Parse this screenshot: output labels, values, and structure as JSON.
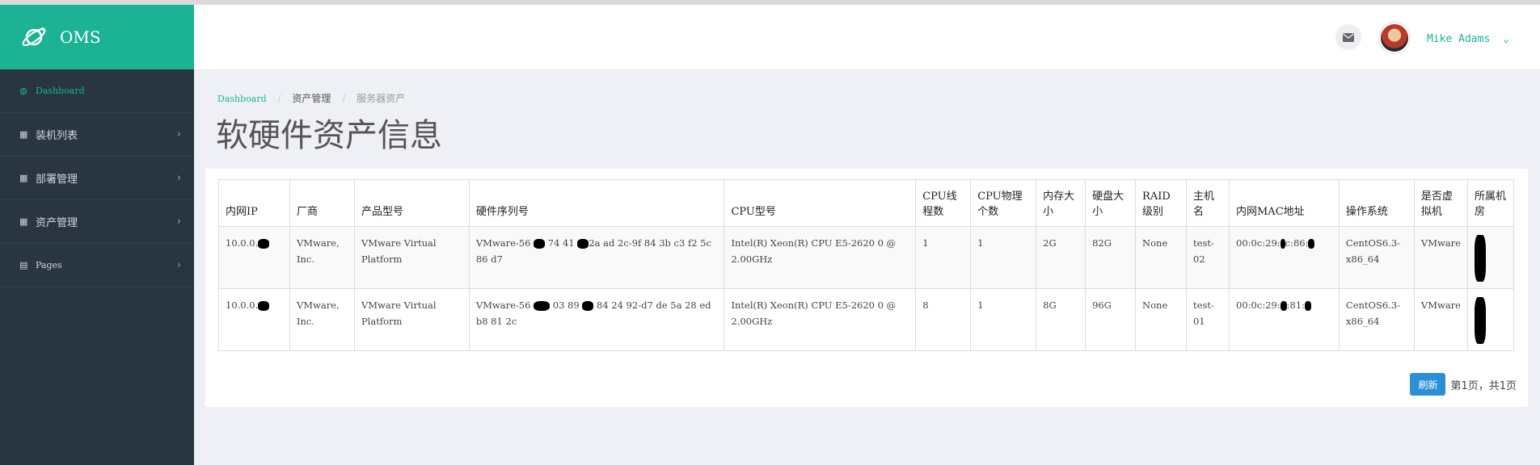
{
  "app": {
    "name": "OMS"
  },
  "sidebar": {
    "items": [
      {
        "label": "Dashboard",
        "icon": "dashboard-icon"
      },
      {
        "label": "装机列表",
        "icon": "table-icon"
      },
      {
        "label": "部署管理",
        "icon": "table-icon"
      },
      {
        "label": "资产管理",
        "icon": "table-icon"
      },
      {
        "label": "Pages",
        "icon": "file-icon"
      }
    ]
  },
  "header": {
    "username": "Mike Adams"
  },
  "breadcrumb": [
    "Dashboard",
    "资产管理",
    "服务器资产"
  ],
  "page_title": "软硬件资产信息",
  "table": {
    "headers": [
      "内网IP",
      "厂商",
      "产品型号",
      "硬件序列号",
      "CPU型号",
      "CPU线程数",
      "CPU物理个数",
      "内存大小",
      "硬盘大小",
      "RAID级别",
      "主机名",
      "内网MAC地址",
      "操作系统",
      "是否虚拟机",
      "所属机房"
    ],
    "rows": [
      {
        "ip": "10.0.0.",
        "vendor": "VMware, Inc.",
        "model": "VMware Virtual Platform",
        "serial_a": "VMware-56",
        "serial_b": "74 41",
        "serial_c": "2a ad 2c-9f 84 3b c3 f2 5c 86 d7",
        "cpu_model": "Intel(R) Xeon(R) CPU E5-2620 0 @ 2.00GHz",
        "cpu_threads": "1",
        "cpu_physical": "1",
        "memory": "2G",
        "disk": "82G",
        "raid": "None",
        "hostname": "test-02",
        "mac_a": "00:0c:29:",
        "mac_b": "c:86:",
        "os": "CentOS6.3-x86_64",
        "is_vm": "VMware",
        "room": ""
      },
      {
        "ip": "10.0.0.",
        "vendor": "VMware, Inc.",
        "model": "VMware Virtual Platform",
        "serial_a": "VMware-56",
        "serial_b": "03 89",
        "serial_c": "84 24 92-d7 de 5a 28 ed b8 81 2c",
        "cpu_model": "Intel(R) Xeon(R) CPU E5-2620 0 @ 2.00GHz",
        "cpu_threads": "8",
        "cpu_physical": "1",
        "memory": "8G",
        "disk": "96G",
        "raid": "None",
        "hostname": "test-01",
        "mac_a": "00:0c:29:",
        "mac_b": ":81:",
        "os": "CentOS6.3-x86_64",
        "is_vm": "VMware",
        "room": ""
      }
    ]
  },
  "footer": {
    "refresh_label": "刷新",
    "pager_text": "第1页，共1页"
  },
  "colors": {
    "brand": "#1bb394",
    "sidebar": "#2a3542",
    "primary_button": "#2b8fd6"
  }
}
